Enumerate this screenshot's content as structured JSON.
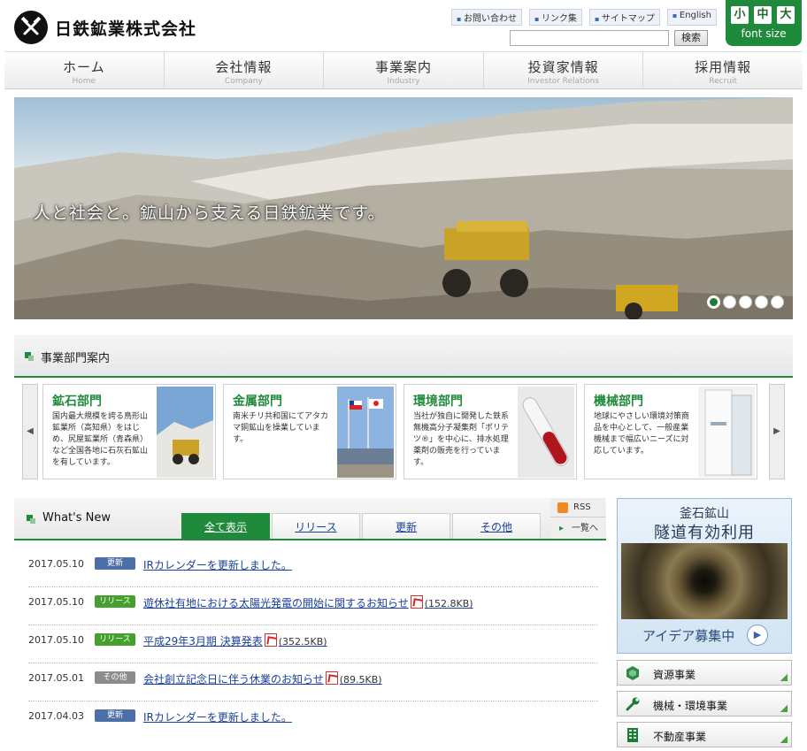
{
  "header": {
    "company_name": "日鉄鉱業株式会社",
    "top_links": [
      "お問い合わせ",
      "リンク集",
      "サイトマップ",
      "English"
    ],
    "search": {
      "placeholder": "",
      "button_label": "検索"
    },
    "font_size": {
      "small": "小",
      "medium": "中",
      "large": "大",
      "label": "font size"
    }
  },
  "nav": [
    {
      "ja": "ホーム",
      "en": "Home"
    },
    {
      "ja": "会社情報",
      "en": "Company"
    },
    {
      "ja": "事業案内",
      "en": "Industry"
    },
    {
      "ja": "投資家情報",
      "en": "Investor Relations"
    },
    {
      "ja": "採用情報",
      "en": "Recruit"
    }
  ],
  "hero": {
    "caption": "人と社会と。鉱山から支える日鉄鉱業です。",
    "slide_count": 5,
    "active_slide": 1
  },
  "divisions": {
    "title": "事業部門案内",
    "cards": [
      {
        "title": "鉱石部門",
        "desc": "国内最大規模を誇る鳥形山鉱業所（高知県）をはじめ、尻屋鉱業所（青森県）など全国各地に石灰石鉱山を有しています。"
      },
      {
        "title": "金属部門",
        "desc": "南米チリ共和国にてアタカマ銅鉱山を操業しています。"
      },
      {
        "title": "環境部門",
        "desc": "当社が独自に開発した鉄系無機高分子凝集剤「ポリテツ®」を中心に、排水処理薬剤の販売を行っています。"
      },
      {
        "title": "機械部門",
        "desc": "地球にやさしい環境対策商品を中心として、一般産業機械まで幅広いニーズに対応しています。"
      }
    ]
  },
  "news": {
    "title": "What's New",
    "tabs": [
      "全て表示",
      "リリース",
      "更新",
      "その他"
    ],
    "rss_label": "RSS",
    "list_label": "一覧へ",
    "items": [
      {
        "date": "2017.05.10",
        "badge": "更新",
        "text": "IRカレンダーを更新しました。",
        "pdf": false,
        "size": ""
      },
      {
        "date": "2017.05.10",
        "badge": "リリース",
        "text": "遊休社有地における太陽光発電の開始に関するお知らせ",
        "pdf": true,
        "size": "(152.8KB)"
      },
      {
        "date": "2017.05.10",
        "badge": "リリース",
        "text": "平成29年3月期 決算発表",
        "pdf": true,
        "size": "(352.5KB)"
      },
      {
        "date": "2017.05.01",
        "badge": "その他",
        "text": "会社創立記念日に伴う休業のお知らせ",
        "pdf": true,
        "size": "(89.5KB)"
      },
      {
        "date": "2017.04.03",
        "badge": "更新",
        "text": "IRカレンダーを更新しました。",
        "pdf": false,
        "size": ""
      }
    ]
  },
  "sidebar": {
    "banner": {
      "line1": "釜石鉱山",
      "line2": "隧道有効利用",
      "cta": "アイデア募集中"
    },
    "items": [
      "資源事業",
      "機械・環境事業",
      "不動産事業"
    ]
  },
  "colors": {
    "brand_green": "#1f8a3c",
    "link_blue": "#1a3f9a",
    "badge_update": "#4d6fa8",
    "badge_release": "#46a02f",
    "badge_other": "#8c8c8c"
  }
}
